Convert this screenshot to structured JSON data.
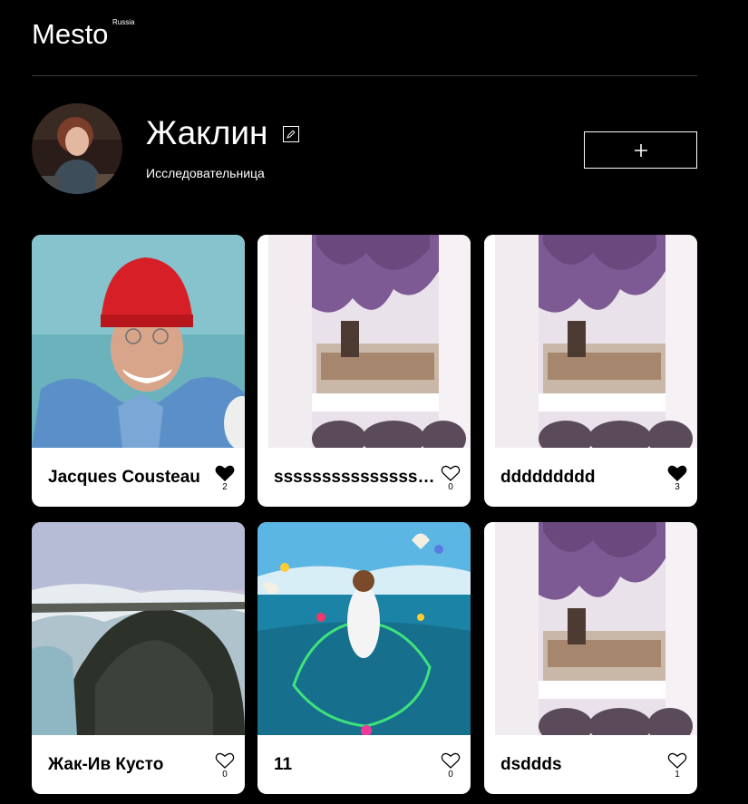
{
  "header": {
    "logo": "Mesto",
    "logo_sup": "Russia"
  },
  "profile": {
    "name": "Жаклин",
    "about": "Исследовательница",
    "add_button_icon": "plus-icon",
    "edit_button_icon": "pencil-icon"
  },
  "cards": [
    {
      "title": "Jacques Cousteau",
      "likes": "2",
      "liked": true
    },
    {
      "title": "ssssssssssssssssssss",
      "likes": "0",
      "liked": false
    },
    {
      "title": "ddddddddd",
      "likes": "3",
      "liked": true
    },
    {
      "title": "Жак-Ив Кусто",
      "likes": "0",
      "liked": false
    },
    {
      "title": "11",
      "likes": "0",
      "liked": false
    },
    {
      "title": "dsddds",
      "likes": "1",
      "liked": false
    }
  ],
  "colors": {
    "background": "#000000",
    "card": "#ffffff",
    "text_dark": "#000000",
    "text_light": "#ffffff"
  }
}
